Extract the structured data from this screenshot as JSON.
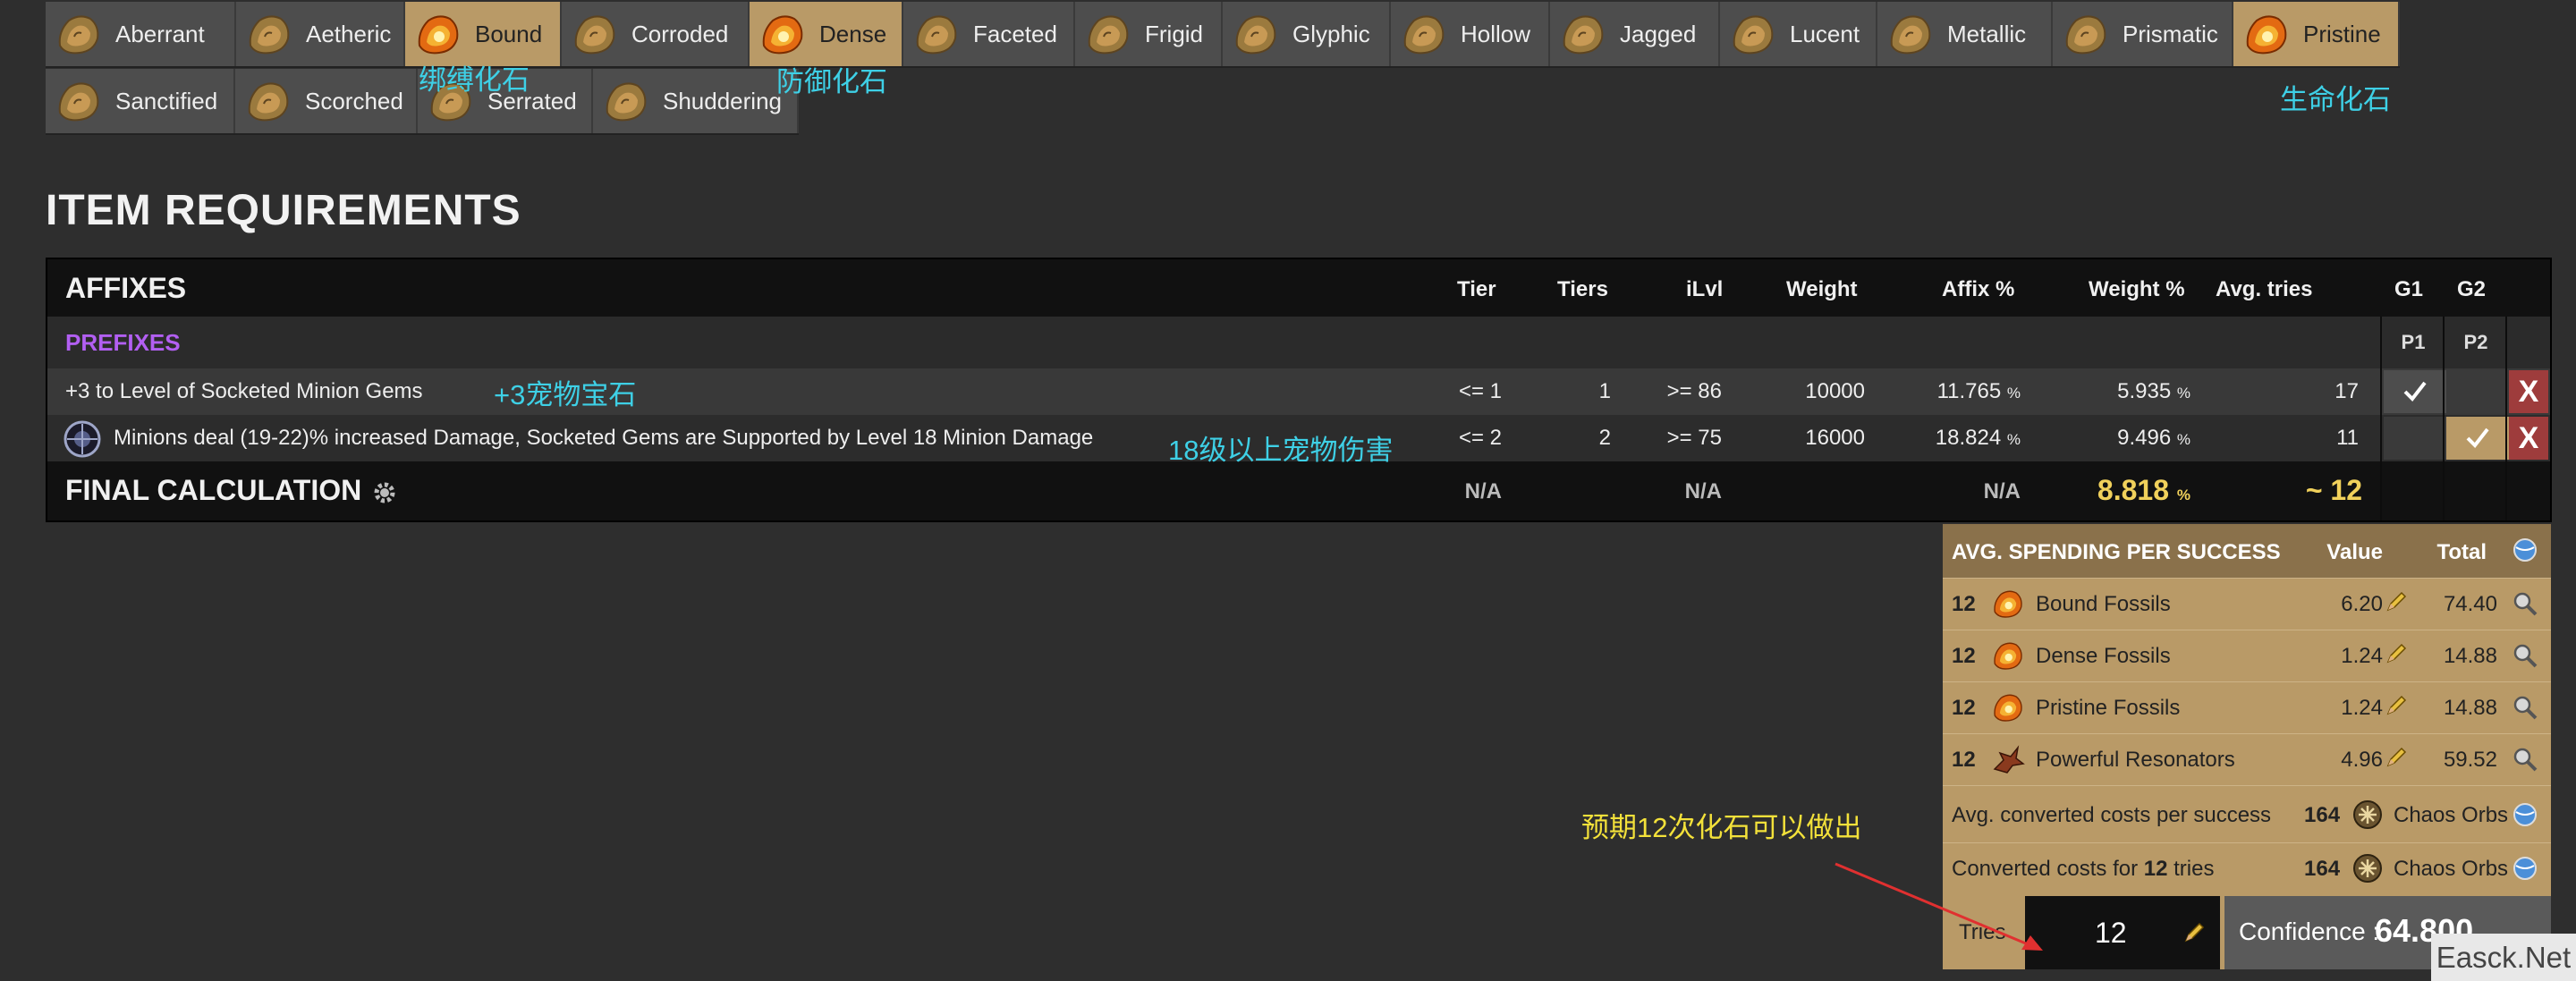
{
  "fossils_row1": [
    {
      "label": "Aberrant",
      "selected": false
    },
    {
      "label": "Aetheric",
      "selected": false
    },
    {
      "label": "Bound",
      "selected": true
    },
    {
      "label": "Corroded",
      "selected": false
    },
    {
      "label": "Dense",
      "selected": true
    },
    {
      "label": "Faceted",
      "selected": false
    },
    {
      "label": "Frigid",
      "selected": false
    },
    {
      "label": "Glyphic",
      "selected": false
    },
    {
      "label": "Hollow",
      "selected": false
    },
    {
      "label": "Jagged",
      "selected": false
    },
    {
      "label": "Lucent",
      "selected": false
    },
    {
      "label": "Metallic",
      "selected": false
    },
    {
      "label": "Prismatic",
      "selected": false
    },
    {
      "label": "Pristine",
      "selected": true
    }
  ],
  "fossils_row2": [
    {
      "label": "Sanctified",
      "selected": false
    },
    {
      "label": "Scorched",
      "selected": false
    },
    {
      "label": "Serrated",
      "selected": false
    },
    {
      "label": "Shuddering",
      "selected": false
    }
  ],
  "annotations": {
    "bound": "绑缚化石",
    "dense": "防御化石",
    "pristine": "生命化石",
    "minion_gems": "+3宠物宝石",
    "minion_damage": "18级以上宠物伤害",
    "expect": "预期12次化石可以做出"
  },
  "section_title": "ITEM REQUIREMENTS",
  "table": {
    "headers": {
      "affixes": "AFFIXES",
      "tier": "Tier",
      "tiers": "Tiers",
      "ilvl": "iLvl",
      "weight": "Weight",
      "affix_pct": "Affix %",
      "weight_pct": "Weight %",
      "avg_tries": "Avg. tries",
      "g1": "G1",
      "g2": "G2"
    },
    "prefixes_label": "PREFIXES",
    "p1": "P1",
    "p2": "P2",
    "rows": [
      {
        "text": "+3 to Level of Socketed Minion Gems",
        "tier": "<= 1",
        "tiers": "1",
        "ilvl": ">= 86",
        "weight": "10000",
        "affix_pct": "11.765",
        "weight_pct": "5.935",
        "avg_tries": "17",
        "x": "X"
      },
      {
        "text": "Minions deal (19-22)% increased Damage, Socketed Gems are Supported by Level 18 Minion Damage",
        "tier": "<= 2",
        "tiers": "2",
        "ilvl": ">= 75",
        "weight": "16000",
        "affix_pct": "18.824",
        "weight_pct": "9.496",
        "avg_tries": "11",
        "x": "X"
      }
    ],
    "percent": "%",
    "final": {
      "label": "FINAL CALCULATION",
      "tier": "N/A",
      "ilvl": "N/A",
      "affix_pct": "N/A",
      "weight_pct": "8.818",
      "avg_tries": "~ 12"
    }
  },
  "spending": {
    "header": "AVG. SPENDING PER SUCCESS",
    "value_label": "Value",
    "total_label": "Total",
    "items": [
      {
        "qty": "12",
        "name": "Bound Fossils",
        "value": "6.20",
        "total": "74.40"
      },
      {
        "qty": "12",
        "name": "Dense Fossils",
        "value": "1.24",
        "total": "14.88"
      },
      {
        "qty": "12",
        "name": "Pristine Fossils",
        "value": "1.24",
        "total": "14.88"
      },
      {
        "qty": "12",
        "name": "Powerful Resonators",
        "value": "4.96",
        "total": "59.52"
      }
    ],
    "converted_per_success_label": "Avg. converted costs per success",
    "converted_per_success_value": "164",
    "converted_for_label_pre": "Converted costs for",
    "converted_for_tries": "12",
    "converted_for_label_post": "tries",
    "converted_for_value": "164",
    "currency": "Chaos Orbs",
    "tries_label": "Tries",
    "tries_value": "12",
    "confidence_label": "Confidence :",
    "confidence_value": "64.800"
  },
  "watermark": "Easck.Net",
  "colors": {
    "selected_tab": "#b99a67",
    "tab": "#4d4d4d",
    "prefix": "#b25ff2",
    "remove": "#9e3c3c",
    "annotation": "#3ed0e6",
    "arrow": "#e03030"
  }
}
